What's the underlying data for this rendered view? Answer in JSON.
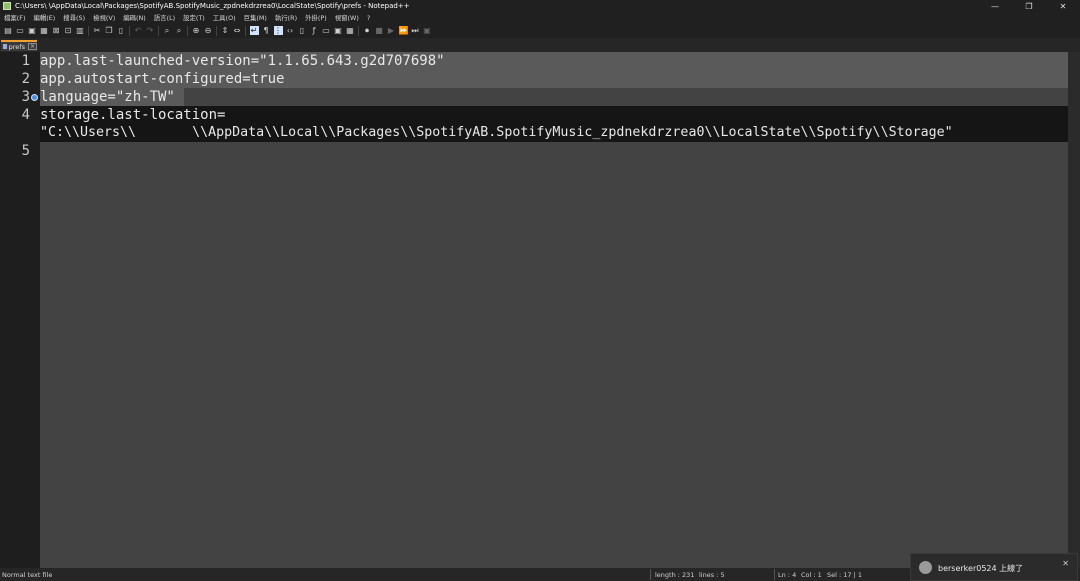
{
  "window": {
    "title": "C:\\Users\\      \\AppData\\Local\\Packages\\SpotifyAB.SpotifyMusic_zpdnekdrzrea0\\LocalState\\Spotify\\prefs - Notepad++",
    "minimize": "—",
    "maximize": "❐",
    "close": "✕"
  },
  "menu": [
    "檔案(F)",
    "編輯(E)",
    "搜尋(S)",
    "檢視(V)",
    "編碼(N)",
    "語言(L)",
    "設定(T)",
    "工具(O)",
    "巨集(M)",
    "執行(R)",
    "外掛(P)",
    "視窗(W)",
    "?"
  ],
  "tab": {
    "label": "prefs"
  },
  "editor": {
    "lines": [
      {
        "num": "1",
        "text": "app.last-launched-version=\"1.1.65.643.g2d707698\""
      },
      {
        "num": "2",
        "text": "app.autostart-configured=true"
      },
      {
        "num": "3",
        "text": "language=\"zh-TW\""
      },
      {
        "num": "4",
        "text": "storage.last-location="
      },
      {
        "num": "",
        "text": "\"C:\\\\Users\\\\       \\\\AppData\\\\Local\\\\Packages\\\\SpotifyAB.SpotifyMusic_zpdnekdrzrea0\\\\LocalState\\\\Spotify\\\\Storage\""
      },
      {
        "num": "5",
        "text": ""
      }
    ]
  },
  "status": {
    "file_type": "Normal text file",
    "length": "length : 231",
    "lines": "lines : 5",
    "ln": "Ln : 4",
    "col": "Col : 1",
    "sel": "Sel : 17 | 1"
  },
  "notification": {
    "text": "berserker0524 上線了",
    "close": "✕"
  },
  "colors": {
    "tab_accent": "#f0a030",
    "bookmark": "#4a90e2",
    "editor_bg": "#434343"
  }
}
